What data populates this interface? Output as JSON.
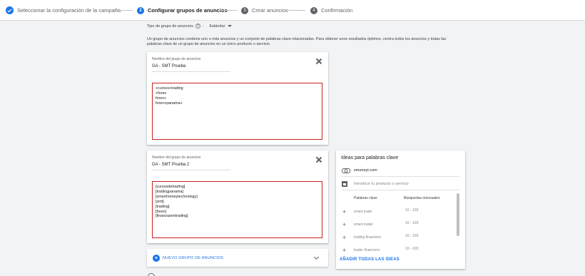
{
  "stepper": {
    "steps": [
      {
        "number": "",
        "label": "Seleccionar la configuración de la campaña",
        "state": "done"
      },
      {
        "number": "2",
        "label": "Configurar grupos de anuncios",
        "state": "active"
      },
      {
        "number": "3",
        "label": "Crear anuncios",
        "state": "pending"
      },
      {
        "number": "4",
        "label": "Confirmación",
        "state": "pending"
      }
    ]
  },
  "ad_group_type": {
    "label": "Tipo de grupo de anuncios",
    "help": "?",
    "separator": ":",
    "value": "Estándar"
  },
  "description": "Un grupo de anuncios contiene uno o más anuncios y un conjunto de palabras clave relacionadas. Para obtener unos resultados óptimos, centra todos los anuncios y todas las palabras clave de un grupo de anuncios en un único producto o servicio.",
  "ad_groups": [
    {
      "field_label": "Nombre del grupo de anuncios",
      "name": "GA - SMT Prueba",
      "keywords": [
        "+cursos+trading",
        "+forex",
        "forex+",
        "forex+panama+"
      ]
    },
    {
      "field_label": "Nombre del grupo de anuncios",
      "name": "GA - SMT Prueba 2",
      "keywords": [
        "[cursosdetrading]",
        "[tradingpanama]",
        "[smartmoneytechnology]",
        "[smt]",
        "[trading]",
        "[forex]",
        "[finanzasentrading]"
      ]
    }
  ],
  "new_group": {
    "label": "NUEVO GRUPO DE ANUNCIOS"
  },
  "ideas": {
    "title": "Ideas para palabras clave",
    "website": "smoneyt.com",
    "product_placeholder": "Introduce tu producto o servicio",
    "col_keywords": "Palabras clave",
    "col_searches": "Búsquedas mensuales",
    "rows": [
      {
        "keyword": "smart trade",
        "searches": "10 - 100"
      },
      {
        "keyword": "smart trader",
        "searches": "10 - 100"
      },
      {
        "keyword": "trading financiero",
        "searches": "10 - 100"
      },
      {
        "keyword": "trader financiero",
        "searches": "10 - 100"
      }
    ],
    "add_all": "AÑADIR TODAS LAS IDEAS"
  },
  "colors": {
    "accent": "#1a73e8",
    "error": "#c5221f",
    "background": "#f1f3f4"
  },
  "icons": {
    "step1": "check-circle-icon",
    "help": "help-circle-icon",
    "close": "close-icon",
    "add_group": "add-circle-icon",
    "expand": "chevron-down-icon",
    "website": "link-icon",
    "product": "store-icon",
    "add_keyword": "plus-icon"
  }
}
